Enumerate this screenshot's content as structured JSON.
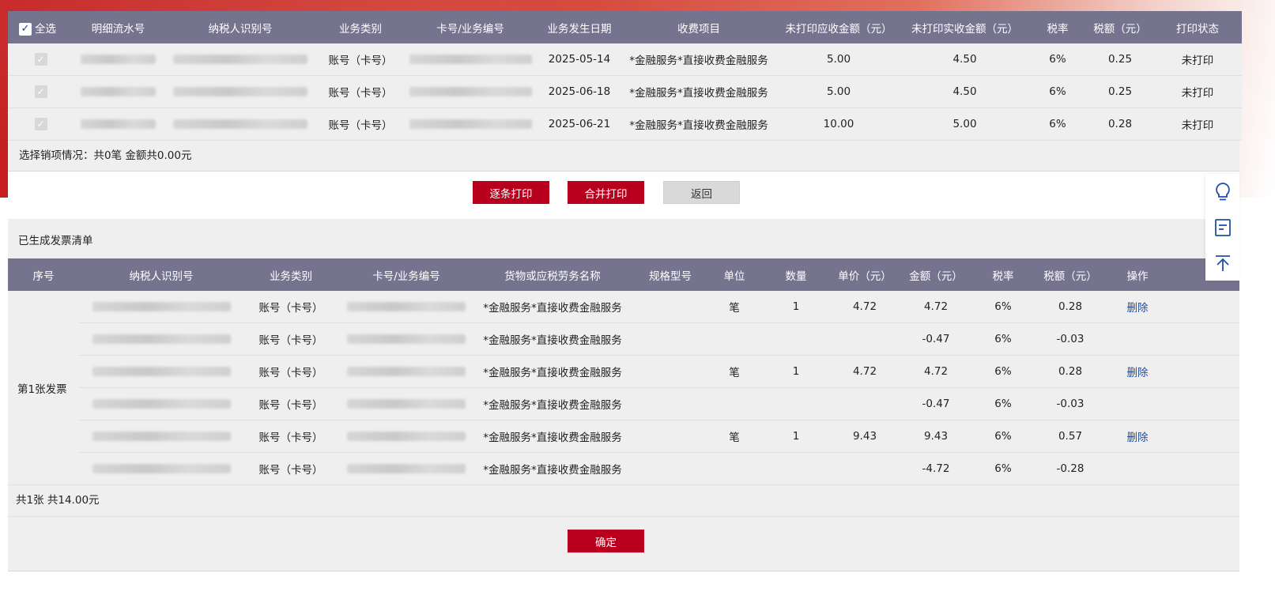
{
  "top_table": {
    "select_all_label": "全选",
    "headers": [
      "明细流水号",
      "纳税人识别号",
      "业务类别",
      "卡号/业务编号",
      "业务发生日期",
      "收费项目",
      "未打印应收金额（元）",
      "未打印实收金额（元）",
      "税率",
      "税额（元）",
      "打印状态"
    ],
    "rows": [
      {
        "category": "账号（卡号）",
        "date": "2025-05-14",
        "item": "*金融服务*直接收费金融服务",
        "receivable": "5.00",
        "received": "4.50",
        "rate": "6%",
        "tax": "0.25",
        "status": "未打印"
      },
      {
        "category": "账号（卡号）",
        "date": "2025-06-18",
        "item": "*金融服务*直接收费金融服务",
        "receivable": "5.00",
        "received": "4.50",
        "rate": "6%",
        "tax": "0.25",
        "status": "未打印"
      },
      {
        "category": "账号（卡号）",
        "date": "2025-06-21",
        "item": "*金融服务*直接收费金融服务",
        "receivable": "10.00",
        "received": "5.00",
        "rate": "6%",
        "tax": "0.28",
        "status": "未打印"
      }
    ],
    "summary": "选择销项情况：共0笔 金额共0.00元"
  },
  "buttons": {
    "print_each": "逐条打印",
    "print_merge": "合并打印",
    "back": "返回",
    "confirm": "确定"
  },
  "invoice_list": {
    "title": "已生成发票清单",
    "headers": [
      "序号",
      "纳税人识别号",
      "业务类别",
      "卡号/业务编号",
      "货物或应税劳务名称",
      "规格型号",
      "单位",
      "数量",
      "单价（元）",
      "金额（元）",
      "税率",
      "税额（元）",
      "操作"
    ],
    "group_label": "第1张发票",
    "rows": [
      {
        "category": "账号（卡号）",
        "name": "*金融服务*直接收费金融服务",
        "spec": "",
        "unit": "笔",
        "qty": "1",
        "price": "4.72",
        "amount": "4.72",
        "rate": "6%",
        "tax": "0.28",
        "op": "删除"
      },
      {
        "category": "账号（卡号）",
        "name": "*金融服务*直接收费金融服务",
        "spec": "",
        "unit": "",
        "qty": "",
        "price": "",
        "amount": "-0.47",
        "rate": "6%",
        "tax": "-0.03",
        "op": ""
      },
      {
        "category": "账号（卡号）",
        "name": "*金融服务*直接收费金融服务",
        "spec": "",
        "unit": "笔",
        "qty": "1",
        "price": "4.72",
        "amount": "4.72",
        "rate": "6%",
        "tax": "0.28",
        "op": "删除"
      },
      {
        "category": "账号（卡号）",
        "name": "*金融服务*直接收费金融服务",
        "spec": "",
        "unit": "",
        "qty": "",
        "price": "",
        "amount": "-0.47",
        "rate": "6%",
        "tax": "-0.03",
        "op": ""
      },
      {
        "category": "账号（卡号）",
        "name": "*金融服务*直接收费金融服务",
        "spec": "",
        "unit": "笔",
        "qty": "1",
        "price": "9.43",
        "amount": "9.43",
        "rate": "6%",
        "tax": "0.57",
        "op": "删除"
      },
      {
        "category": "账号（卡号）",
        "name": "*金融服务*直接收费金融服务",
        "spec": "",
        "unit": "",
        "qty": "",
        "price": "",
        "amount": "-4.72",
        "rate": "6%",
        "tax": "-0.28",
        "op": ""
      }
    ],
    "summary": "共1张 共14.00元"
  },
  "side_tools": [
    "lightbulb-icon",
    "document-icon",
    "back-to-top-icon"
  ],
  "colors": {
    "header_bg": "#76738f",
    "primary_red": "#b8001e",
    "link_blue": "#1f4fa8"
  }
}
